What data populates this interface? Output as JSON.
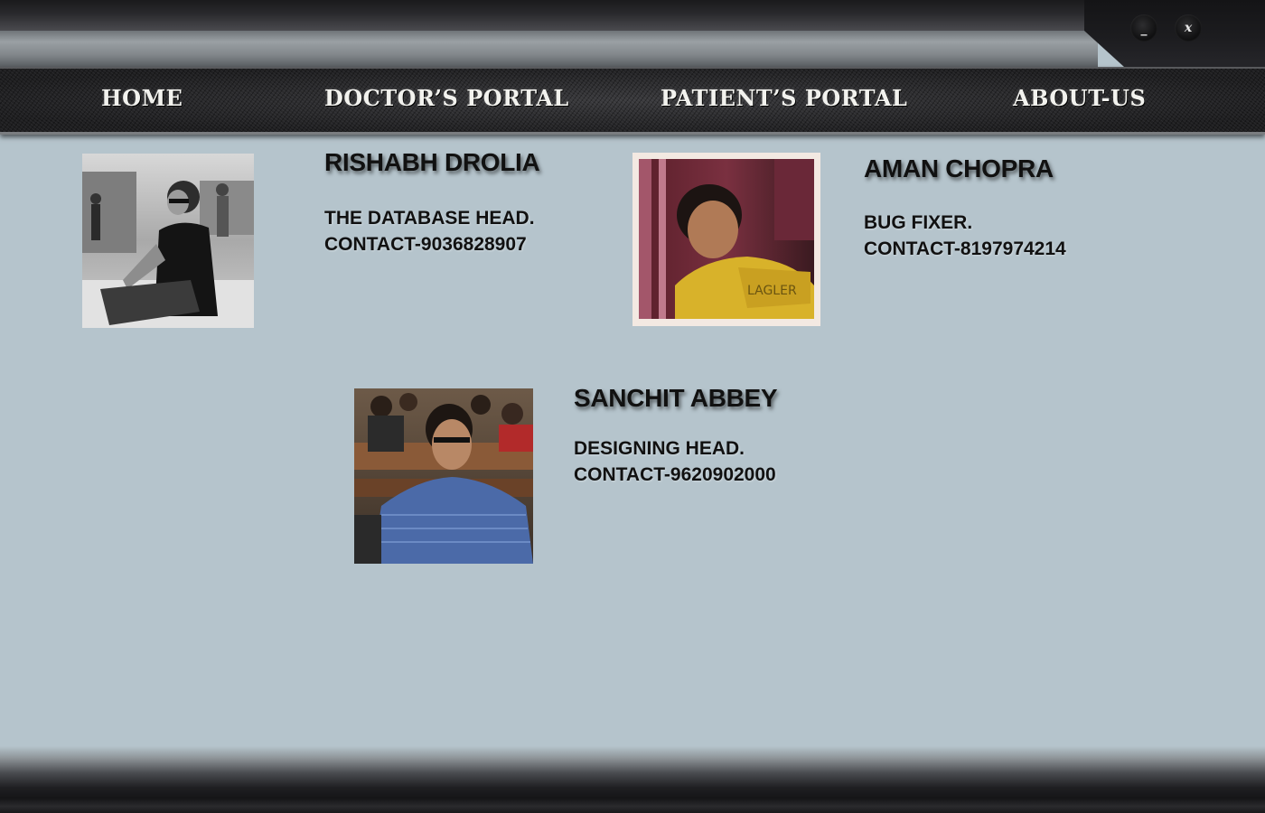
{
  "window": {
    "minimize_label": "_",
    "close_label": "x"
  },
  "nav": {
    "items": [
      {
        "label": "Home"
      },
      {
        "label": "Doctor’s Portal"
      },
      {
        "label": "Patient’s Portal"
      },
      {
        "label": "About-Us"
      }
    ]
  },
  "team": [
    {
      "name": "RISHABH DROLIA",
      "role": "THE DATABASE HEAD.",
      "contact": "CONTACT-9036828907"
    },
    {
      "name": "AMAN CHOPRA",
      "role": "BUG FIXER.",
      "contact": "CONTACT-8197974214"
    },
    {
      "name": "SANCHIT ABBEY",
      "role": "DESIGNING HEAD.",
      "contact": "CONTACT-9620902000"
    }
  ]
}
